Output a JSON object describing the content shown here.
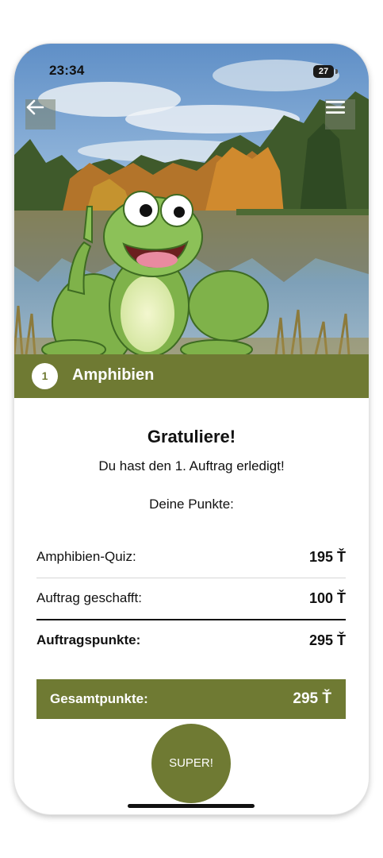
{
  "status_bar": {
    "time": "23:34",
    "battery": "27"
  },
  "header": {
    "mission_number": "1",
    "mission_title": "Amphibien"
  },
  "result": {
    "title": "Gratuliere!",
    "subtitle": "Du hast den 1. Auftrag erledigt!",
    "points_heading": "Deine Punkte:",
    "rows": [
      {
        "label": "Amphibien-Quiz:",
        "value": "195 Ť"
      },
      {
        "label": "Auftrag geschafft:",
        "value": "100 Ť"
      },
      {
        "label": "Auftragspunkte:",
        "value": "295 Ť"
      }
    ],
    "grand_total": {
      "label": "Gesamtpunkte:",
      "value": "295 Ť"
    }
  },
  "actions": {
    "super_label": "SUPER!"
  },
  "icons": {
    "back": "arrow-left-icon",
    "menu": "hamburger-menu-icon",
    "location": "location-arrow-icon",
    "signal": "cellular-signal-icon",
    "wifi": "wifi-icon",
    "battery": "battery-icon"
  },
  "colors": {
    "accent": "#6f7a33",
    "text": "#111111",
    "background": "#ffffff"
  }
}
